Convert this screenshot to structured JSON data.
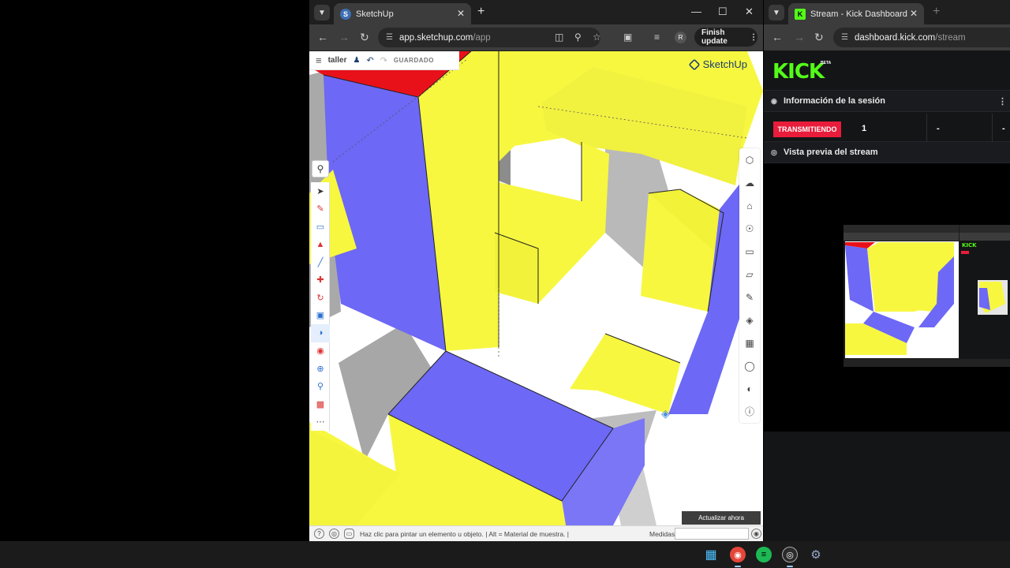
{
  "left_window": {
    "tab_title": "SketchUp",
    "url_host": "app.sketchup.com",
    "url_path": "/app",
    "finish_update_label": "Finish update",
    "profile_initial": "R"
  },
  "sketchup": {
    "project_name": "taller",
    "save_state": "GUARDADO",
    "logo_text": "SketchUp",
    "update_now_label": "Actualizar ahora",
    "status_message": "Haz clic para pintar un elemento u objeto. | Alt = Material de muestra. |",
    "measurements_label": "Medidas",
    "measurements_value": "",
    "colors": {
      "yellow": "#f7f740",
      "blue": "#6d68f5",
      "red": "#e8111a",
      "shadow": "#9f9f9f"
    }
  },
  "right_window": {
    "tab_title": "Stream - Kick Dashboard",
    "url_host": "dashboard.kick.com",
    "url_path": "/stream",
    "kick_logo": "KICK",
    "kick_badge": "BETA",
    "session_info_title": "Información de la sesión",
    "live_badge": "TRANSMITIENDO",
    "stat_1": "1",
    "stat_2": "-",
    "stat_3": "-",
    "preview_title": "Vista previa del stream",
    "accent": "#53fc18",
    "live_color": "#e91c3b",
    "mini_logo": "KICK"
  },
  "taskbar": {
    "apps": [
      "windows-start",
      "chrome",
      "spotify",
      "obs",
      "settings"
    ]
  }
}
